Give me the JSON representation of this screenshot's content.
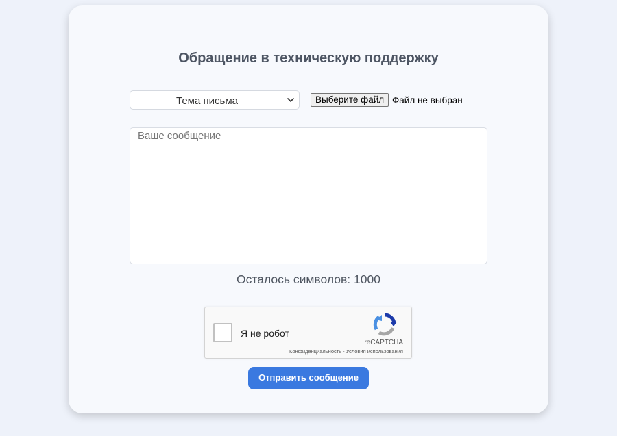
{
  "form": {
    "title": "Обращение в техническую поддержку",
    "topic_select": {
      "selected": "Тема письма"
    },
    "file_input": {
      "button_label": "Выберите файл",
      "status": "Файл не выбран"
    },
    "message": {
      "placeholder": "Ваше сообщение",
      "value": ""
    },
    "char_counter": "Осталось символов: 1000",
    "captcha": {
      "label": "Я не робот",
      "brand": "reCAPTCHA",
      "privacy_link": "Конфиденциальность",
      "separator": " - ",
      "terms_link": "Условия использования"
    },
    "submit_label": "Отправить сообщение"
  },
  "colors": {
    "page_background": "#eef2fa",
    "card_background": "#f7f9fd",
    "accent": "#3a79e0",
    "title_text": "#4d5563"
  },
  "icons": {
    "select_chevron": "chevron-down-icon",
    "captcha_logo": "recaptcha-logo-icon"
  }
}
